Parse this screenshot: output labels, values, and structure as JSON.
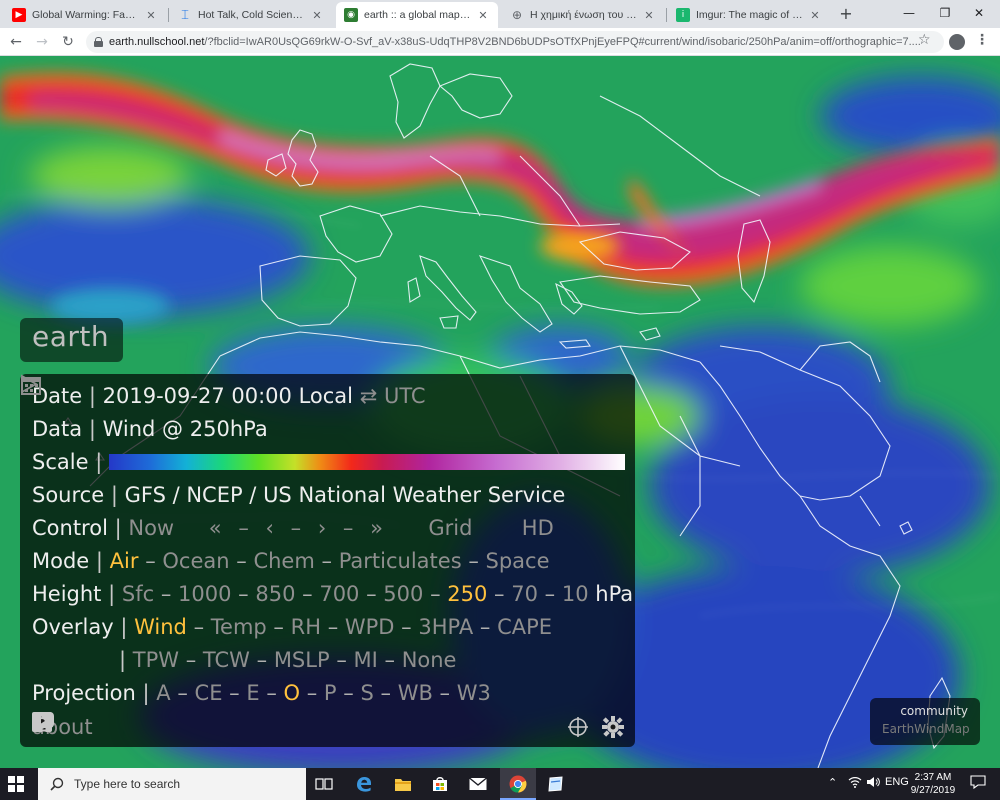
{
  "browser": {
    "tabs": [
      {
        "title": "Global Warming: Fact or Fic",
        "icon": "youtube-icon",
        "color": "#ff0000",
        "active": false
      },
      {
        "title": "Hot Talk, Cold Science: Glob",
        "icon": "bookmark-icon",
        "color": "#1a73e8",
        "active": false
      },
      {
        "title": "earth :: a global map of win",
        "icon": "earth-icon",
        "color": "#2e7d32",
        "active": true
      },
      {
        "title": "Η χημική ένωση του μήνα:",
        "icon": "globe-icon",
        "color": "#5f6368",
        "active": false
      },
      {
        "title": "Imgur: The magic of the Int",
        "icon": "imgur-icon",
        "color": "#1bb76e",
        "active": false
      }
    ],
    "url_host": "earth.nullschool.net",
    "url_path": "/?fbclid=IwAR0UsQG69rkW-O-Svf_aV-x38uS-UdqTHP8V2BND6bUDPsOTfXPnjEyeFPQ#current/wind/isobaric/250hPa/anim=off/orthographic=7...."
  },
  "earth": {
    "logo": "earth",
    "date_label": "Date",
    "date_value": "2019-09-27 00:00 Local",
    "date_toggle": "⇄ UTC",
    "data_label": "Data",
    "data_value": "Wind @ 250hPa",
    "scale_label": "Scale",
    "source_label": "Source",
    "source_value": "GFS / NCEP / US National Weather Service",
    "control_label": "Control",
    "control_now": "Now",
    "control_grid": "Grid",
    "control_hd": "HD",
    "mode_label": "Mode",
    "modes": [
      "Air",
      "Ocean",
      "Chem",
      "Particulates",
      "Space"
    ],
    "mode_selected": "Air",
    "height_label": "Height",
    "heights": [
      "Sfc",
      "1000",
      "850",
      "700",
      "500",
      "250",
      "70",
      "10"
    ],
    "height_selected": "250",
    "height_unit": "hPa",
    "overlay_label": "Overlay",
    "overlays_row1": [
      "Wind",
      "Temp",
      "RH",
      "WPD",
      "3HPA",
      "CAPE"
    ],
    "overlays_row2": [
      "TPW",
      "TCW",
      "MSLP",
      "MI",
      "None"
    ],
    "overlay_selected": "Wind",
    "projection_label": "Projection",
    "projections": [
      "A",
      "CE",
      "E",
      "O",
      "P",
      "S",
      "WB",
      "W3"
    ],
    "projection_selected": "O",
    "about_label": "about",
    "community_line1": "community",
    "community_line2": "EarthWindMap",
    "accent_color": "#ffc13d"
  },
  "taskbar": {
    "search_placeholder": "Type here to search",
    "language": "ENG",
    "time": "2:37 AM",
    "date": "9/27/2019"
  }
}
